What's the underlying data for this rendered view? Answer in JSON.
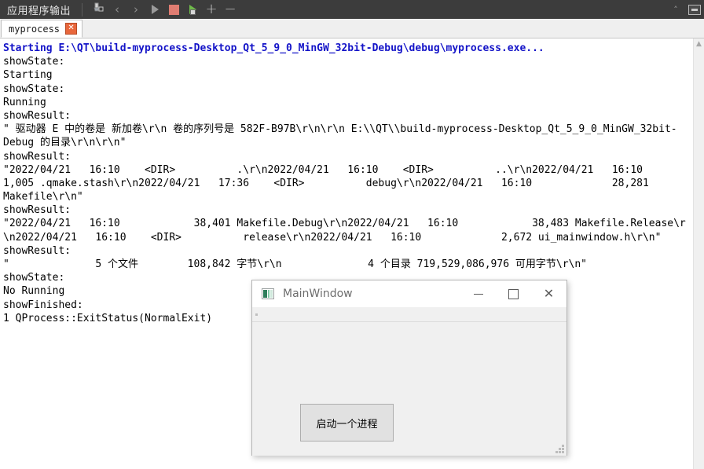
{
  "toolbar": {
    "title": "应用程序输出",
    "buttons": [
      {
        "name": "clear-pane-icon",
        "label": ""
      },
      {
        "name": "previous-item-icon",
        "label": "‹"
      },
      {
        "name": "next-item-icon",
        "label": "›"
      },
      {
        "name": "run-icon",
        "label": ""
      },
      {
        "name": "stop-icon",
        "label": ""
      },
      {
        "name": "debug-icon",
        "label": ""
      },
      {
        "name": "zoom-in-icon",
        "label": "+"
      },
      {
        "name": "zoom-out-icon",
        "label": "−"
      }
    ],
    "right_buttons": [
      {
        "name": "collapse-pane-icon",
        "label": "˄"
      },
      {
        "name": "maximize-pane-icon",
        "label": ""
      }
    ]
  },
  "tabs": [
    {
      "label": "myprocess",
      "close_label": "✕",
      "active": true
    }
  ],
  "output": {
    "lines": [
      {
        "text": "Starting E:\\QT\\build-myprocess-Desktop_Qt_5_9_0_MinGW_32bit-Debug\\debug\\myprocess.exe...",
        "style": "blue"
      },
      {
        "text": "showState:",
        "style": "plain"
      },
      {
        "text": "Starting",
        "style": "plain"
      },
      {
        "text": "showState:",
        "style": "plain"
      },
      {
        "text": "Running",
        "style": "plain"
      },
      {
        "text": "showResult:",
        "style": "plain"
      },
      {
        "text": "\" 驱动器 E 中的卷是 新加卷\\r\\n 卷的序列号是 582F-B97B\\r\\n\\r\\n E:\\\\QT\\\\build-myprocess-Desktop_Qt_5_9_0_MinGW_32bit-",
        "style": "plain"
      },
      {
        "text": "Debug 的目录\\r\\n\\r\\n\"",
        "style": "plain"
      },
      {
        "text": "showResult:",
        "style": "plain"
      },
      {
        "text": "\"2022/04/21   16:10    <DIR>          .\\r\\n2022/04/21   16:10    <DIR>          ..\\r\\n2022/04/21   16:10",
        "style": "plain"
      },
      {
        "text": "1,005 .qmake.stash\\r\\n2022/04/21   17:36    <DIR>          debug\\r\\n2022/04/21   16:10             28,281",
        "style": "plain"
      },
      {
        "text": "Makefile\\r\\n\"",
        "style": "plain"
      },
      {
        "text": "showResult:",
        "style": "plain"
      },
      {
        "text": "\"2022/04/21   16:10            38,401 Makefile.Debug\\r\\n2022/04/21   16:10            38,483 Makefile.Release\\r",
        "style": "plain"
      },
      {
        "text": "\\n2022/04/21   16:10    <DIR>          release\\r\\n2022/04/21   16:10             2,672 ui_mainwindow.h\\r\\n\"",
        "style": "plain"
      },
      {
        "text": "showResult:",
        "style": "plain"
      },
      {
        "text": "\"              5 个文件        108,842 字节\\r\\n              4 个目录 719,529,086,976 可用字节\\r\\n\"",
        "style": "plain"
      },
      {
        "text": "showState:",
        "style": "plain"
      },
      {
        "text": "No Running",
        "style": "plain"
      },
      {
        "text": "showFinished:",
        "style": "plain"
      },
      {
        "text": "1 QProcess::ExitStatus(NormalExit)",
        "style": "plain"
      }
    ]
  },
  "child_window": {
    "title": "MainWindow",
    "minimize_label": "",
    "maximize_label": "",
    "close_label": "✕",
    "button_label": "启动一个进程"
  },
  "colors": {
    "toolbar_bg": "#3c3c3c",
    "link_blue": "#1414c8",
    "stop_red": "#e07d72",
    "run_green": "#6fbb4a",
    "tab_close_orange": "#e8673c"
  }
}
